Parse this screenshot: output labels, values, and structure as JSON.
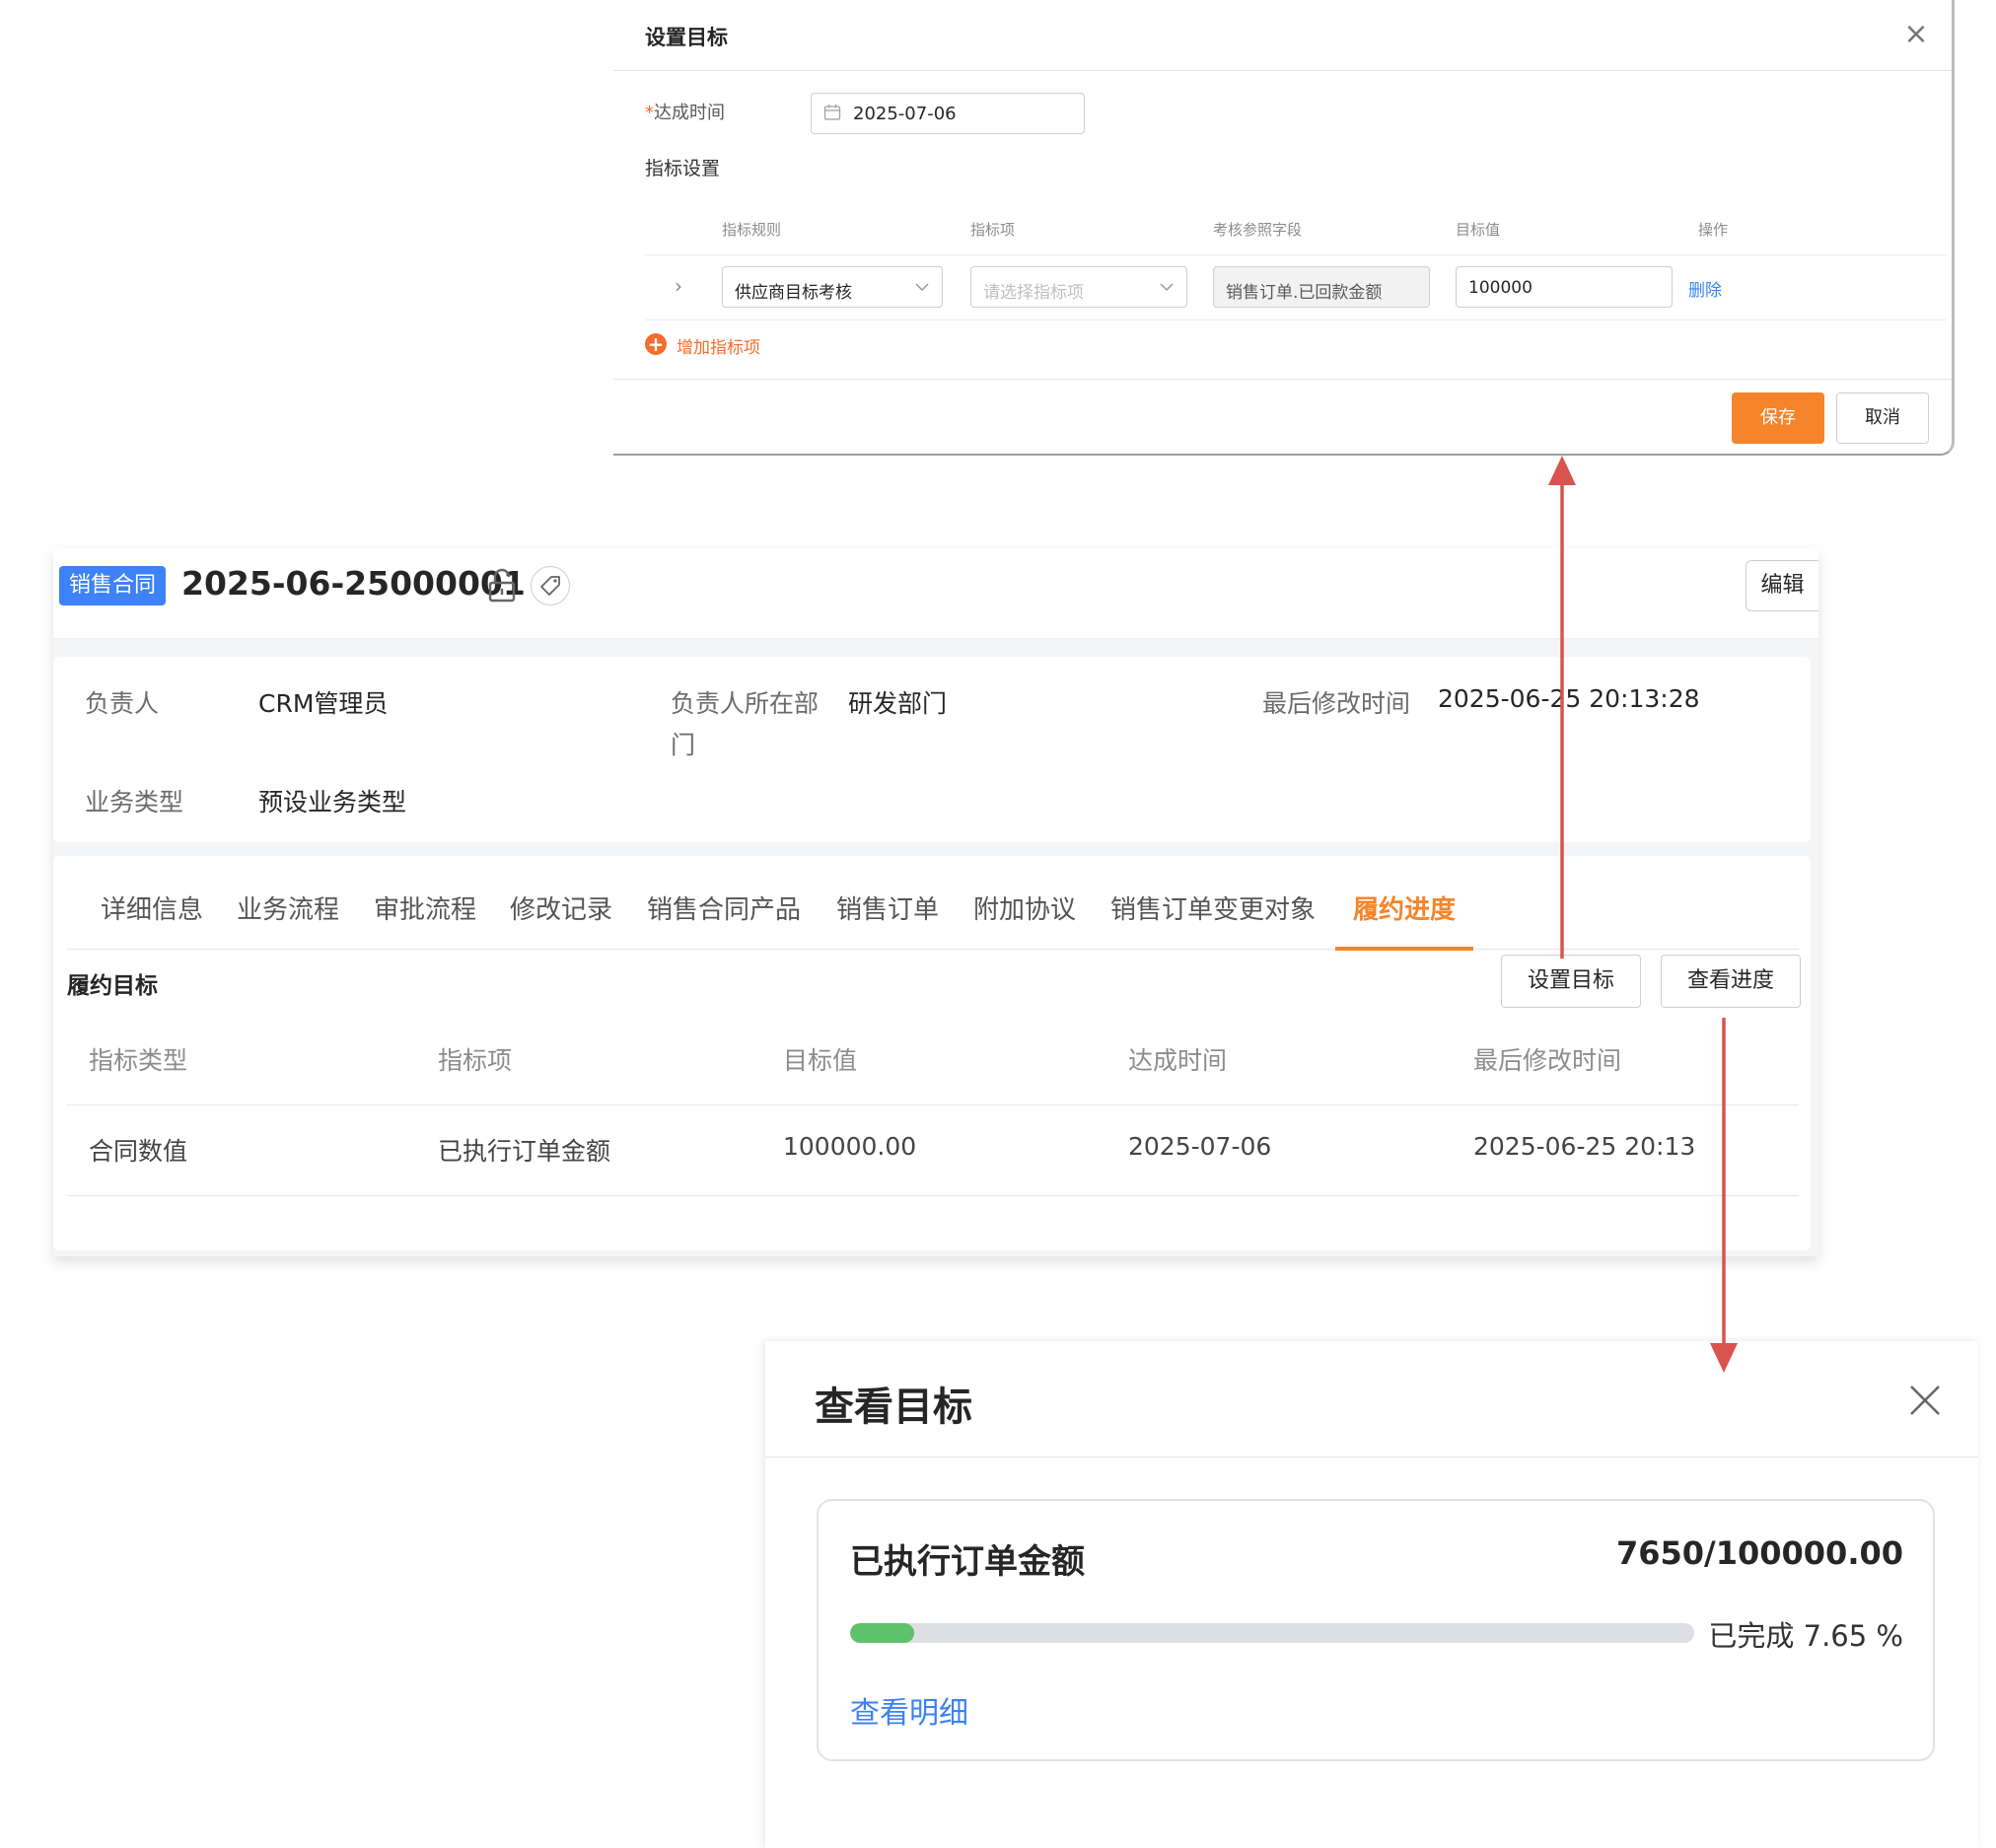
{
  "set_target_dialog": {
    "title": "设置目标",
    "close_glyph": "×",
    "date_label_required": "*",
    "date_label": "达成时间",
    "date_value": "2025-07-06",
    "indicator_section_label": "指标设置",
    "columns": [
      "指标规则",
      "指标项",
      "考核参照字段",
      "目标值",
      "操作"
    ],
    "row": {
      "expand_glyph": "›",
      "rule": "供应商目标考核",
      "item_placeholder": "请选择指标项",
      "ref_field": "销售订单.已回款金额",
      "target_value": "100000",
      "action": "删除"
    },
    "add_indicator": "增加指标项",
    "save": "保存",
    "cancel": "取消"
  },
  "contract": {
    "badge": "销售合同",
    "code": "2025-06-25000001",
    "edit": "编辑",
    "info": {
      "owner_label": "负责人",
      "owner_value": "CRM管理员",
      "dept_label_line1": "负责人所在部",
      "dept_label_line2": "门",
      "dept_value": "研发部门",
      "modified_label": "最后修改时间",
      "modified_value": "2025-06-25 20:13:28",
      "biz_type_label": "业务类型",
      "biz_type_value": "预设业务类型"
    },
    "tabs": [
      "详细信息",
      "业务流程",
      "审批流程",
      "修改记录",
      "销售合同产品",
      "销售订单",
      "附加协议",
      "销售订单变更对象",
      "履约进度"
    ],
    "active_tab": 8,
    "section_title": "履约目标",
    "set_target_btn": "设置目标",
    "view_progress_btn": "查看进度",
    "table": {
      "headers": [
        "指标类型",
        "指标项",
        "目标值",
        "达成时间",
        "最后修改时间"
      ],
      "rows": [
        [
          "合同数值",
          "已执行订单金额",
          "100000.00",
          "2025-07-06",
          "2025-06-25 20:13"
        ]
      ]
    }
  },
  "view_target_dialog": {
    "title": "查看目标",
    "metric_name": "已执行订单金额",
    "ratio": "7650/100000.00",
    "progress_fraction": 0.0765,
    "done_text": "已完成 7.65 %",
    "detail_link": "查看明细"
  },
  "colors": {
    "accent_orange": "#f5842b",
    "link_blue": "#3b82f6",
    "badge_blue": "#3d82f6",
    "progress_green": "#5ec26a",
    "arrow_red": "#d9534f"
  },
  "icons": [
    "close-icon",
    "calendar-icon",
    "chevron-right-icon",
    "chevron-down-icon",
    "plus-circle-icon",
    "lock-icon",
    "tag-icon"
  ]
}
